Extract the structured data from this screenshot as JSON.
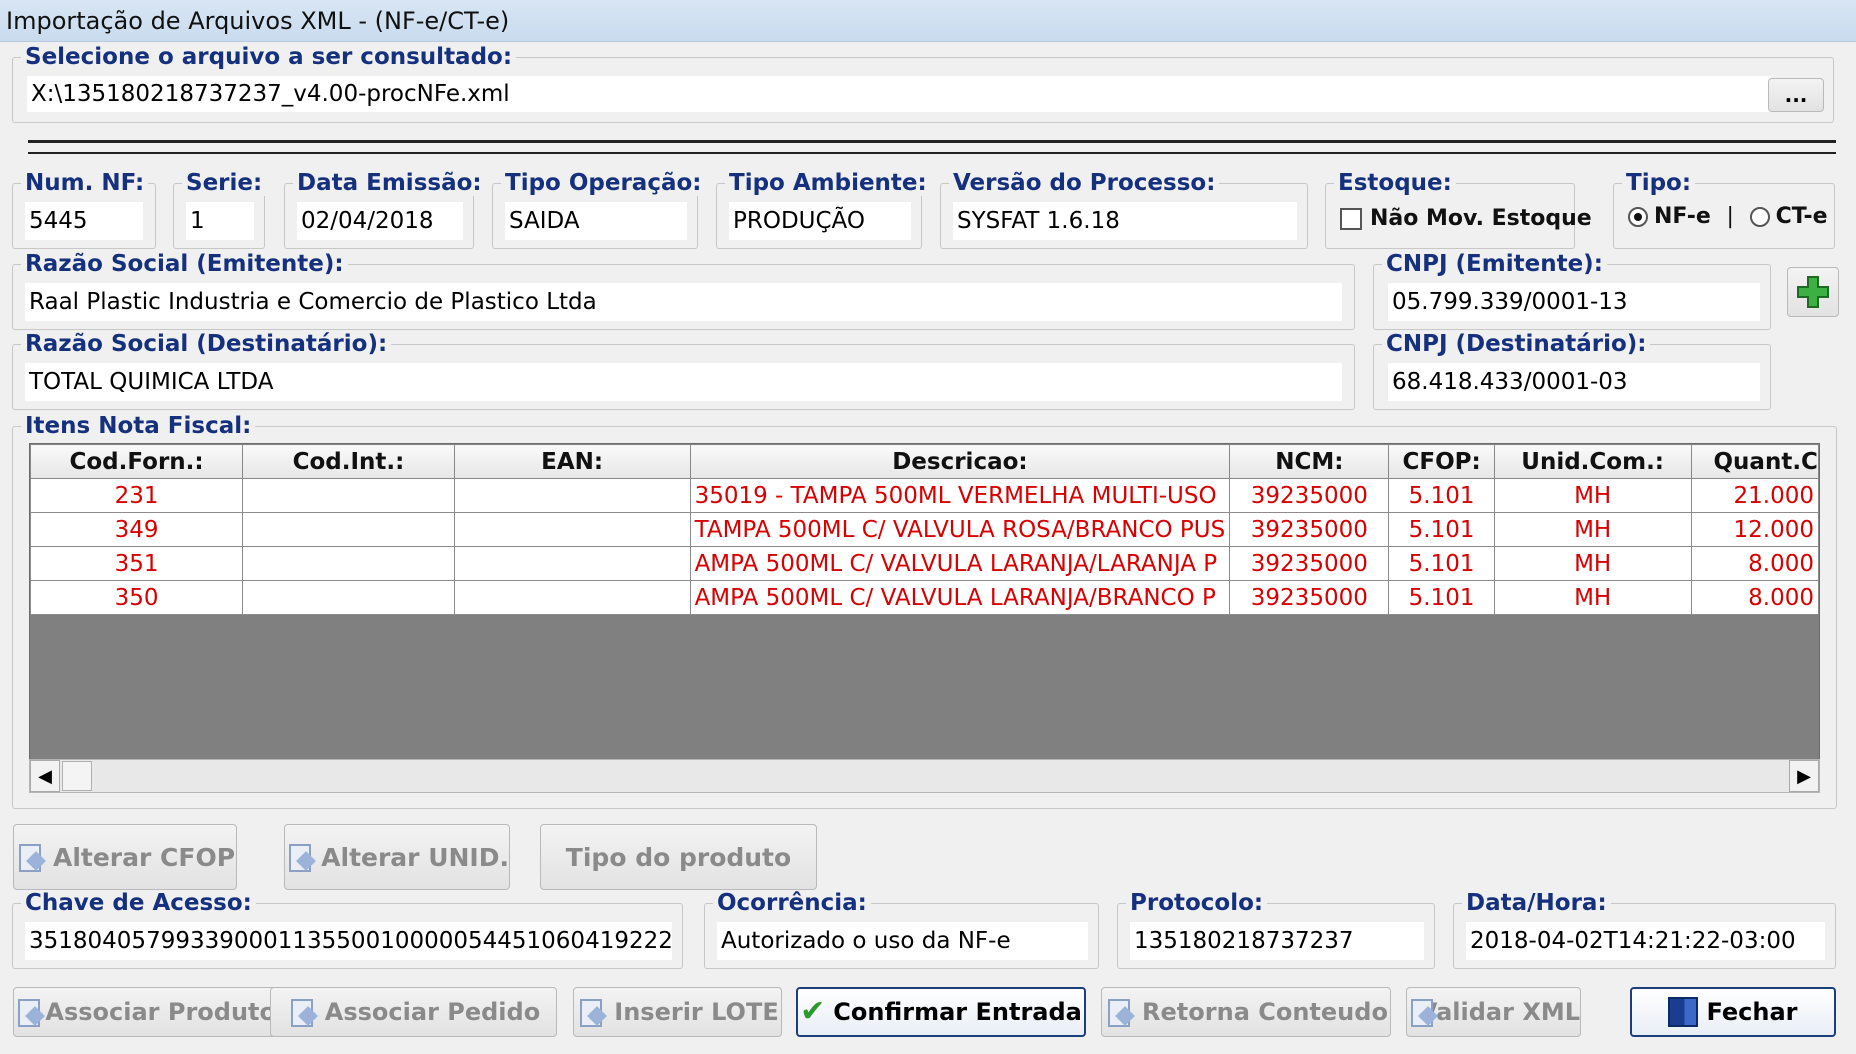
{
  "window": {
    "title": "Importação de Arquivos XML - (NF-e/CT-e)"
  },
  "file": {
    "legend": "Selecione o arquivo a ser consultado:",
    "path": "X:\\135180218737237_v4.00-procNFe.xml",
    "browse_label": "..."
  },
  "header": {
    "num_nf": {
      "label": "Num. NF:",
      "value": "5445"
    },
    "serie": {
      "label": "Serie:",
      "value": "1"
    },
    "data_emissao": {
      "label": "Data Emissão:",
      "value": "02/04/2018"
    },
    "tipo_operacao": {
      "label": "Tipo Operação:",
      "value": "SAIDA"
    },
    "tipo_ambiente": {
      "label": "Tipo Ambiente:",
      "value": "PRODUÇÃO"
    },
    "versao_processo": {
      "label": "Versão do Processo:",
      "value": "SYSFAT 1.6.18"
    },
    "estoque": {
      "label": "Estoque:",
      "checkbox_label": "Não Mov. Estoque",
      "checked": false
    },
    "tipo": {
      "label": "Tipo:",
      "option_nfe": "NF-e",
      "option_cte": "CT-e",
      "selected": "NF-e"
    }
  },
  "emitente": {
    "razao_label": "Razão Social (Emitente):",
    "razao_value": "Raal Plastic Industria e Comercio de Plastico Ltda",
    "cnpj_label": "CNPJ (Emitente):",
    "cnpj_value": "05.799.339/0001-13"
  },
  "destinatario": {
    "razao_label": "Razão Social (Destinatário):",
    "razao_value": "TOTAL QUIMICA LTDA",
    "cnpj_label": "CNPJ (Destinatário):",
    "cnpj_value": "68.418.433/0001-03"
  },
  "itens": {
    "legend": "Itens Nota Fiscal:",
    "columns": [
      "Cod.Forn.:",
      "Cod.Int.:",
      "EAN:",
      "Descricao:",
      "NCM:",
      "CFOP:",
      "Unid.Com.:",
      "Quant.C"
    ],
    "rows": [
      [
        "231",
        "",
        "",
        "35019 - TAMPA 500ML VERMELHA MULTI-USO",
        "39235000",
        "5.101",
        "MH",
        "21.000"
      ],
      [
        "349",
        "",
        "",
        "TAMPA 500ML C/ VALVULA ROSA/BRANCO PUS",
        "39235000",
        "5.101",
        "MH",
        "12.000"
      ],
      [
        "351",
        "",
        "",
        "AMPA 500ML C/ VALVULA LARANJA/LARANJA P",
        "39235000",
        "5.101",
        "MH",
        "8.000"
      ],
      [
        "350",
        "",
        "",
        "AMPA 500ML C/ VALVULA LARANJA/BRANCO P",
        "39235000",
        "5.101",
        "MH",
        "8.000"
      ]
    ]
  },
  "actions_top": {
    "alterar_cfop": "Alterar CFOP",
    "alterar_unid": "Alterar UNID.",
    "tipo_produto": "Tipo do produto"
  },
  "footer_fields": {
    "chave": {
      "label": "Chave de Acesso:",
      "value": "35180405799339000113550010000054451060419222"
    },
    "ocorrencia": {
      "label": "Ocorrência:",
      "value": "Autorizado o uso da NF-e"
    },
    "protocolo": {
      "label": "Protocolo:",
      "value": "135180218737237"
    },
    "data_hora": {
      "label": "Data/Hora:",
      "value": "2018-04-02T14:21:22-03:00"
    }
  },
  "actions_bottom": {
    "associar_produto": "Associar Produto",
    "associar_pedido": "Associar Pedido",
    "inserir_lote": "Inserir LOTE",
    "confirmar_entrada": "Confirmar Entrada",
    "retorna_conteudo": "Retorna Conteudo",
    "validar_xml": "Validar XML",
    "fechar": "Fechar"
  },
  "colors": {
    "legend": "#15317e",
    "item_text": "#d80000",
    "grid_empty": "#808080",
    "accent_add": "#2d9a2d"
  },
  "icons": [
    "add-icon",
    "edit-doc-icon",
    "checkmark-icon",
    "exit-door-icon",
    "scroll-left-icon",
    "scroll-right-icon"
  ]
}
